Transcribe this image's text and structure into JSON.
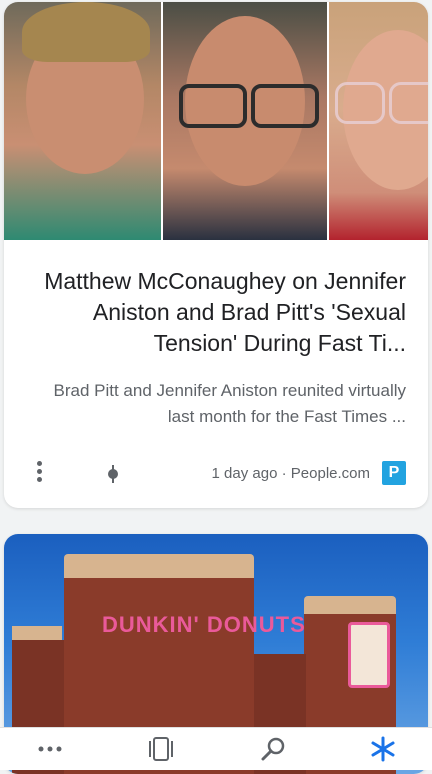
{
  "card1": {
    "headline": "Matthew McConaughey on Jennifer Aniston and Brad Pitt's 'Sexual Tension' During Fast Ti...",
    "snippet": "Brad Pitt and Jennifer Aniston reunited virtually last month for the Fast Times ...",
    "source": "People.com",
    "separator": "·",
    "age": "1 day ago",
    "source_logo_letter": "P",
    "source_logo_color": "#22a3e0"
  },
  "card2": {
    "sign_text": "DUNKIN' DONUTS"
  },
  "navbar": {
    "items": [
      {
        "icon": "more-horizontal-icon"
      },
      {
        "icon": "tabs-icon"
      },
      {
        "icon": "search-icon"
      },
      {
        "icon": "discover-asterisk-icon",
        "color": "#1a73e8"
      }
    ]
  }
}
